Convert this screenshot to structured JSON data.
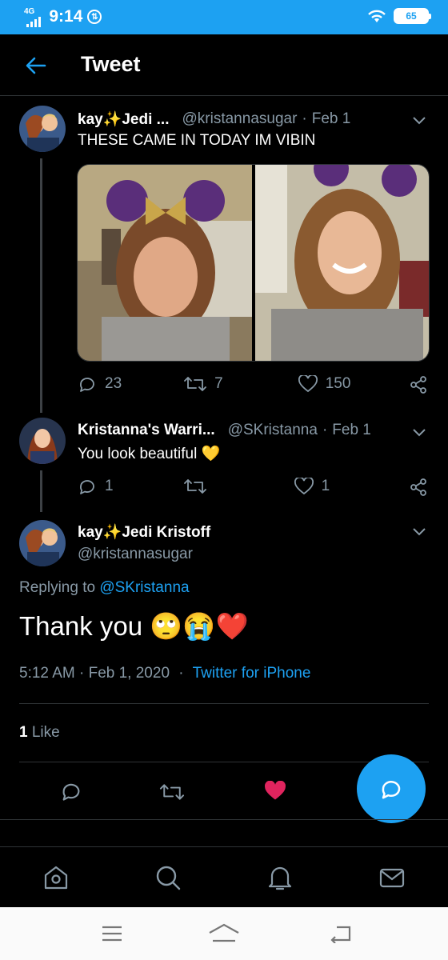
{
  "status_bar": {
    "network": "4G",
    "time": "9:14",
    "battery": "65"
  },
  "header": {
    "title": "Tweet"
  },
  "tweet1": {
    "name": "kay✨Jedi ...",
    "handle": "@kristannasugar",
    "date": "Feb 1",
    "text": "THESE CAME IN TODAY IM VIBIN",
    "replies": "23",
    "retweets": "7",
    "likes": "150"
  },
  "tweet2": {
    "name": "Kristanna's Warri...",
    "handle": "@SKristanna",
    "date": "Feb 1",
    "text": "You look beautiful 💛",
    "replies": "1",
    "likes": "1"
  },
  "main_tweet": {
    "name": "kay✨Jedi Kristoff",
    "handle": "@kristannasugar",
    "replying_prefix": "Replying to",
    "replying_to": "@SKristanna",
    "text": "Thank you 🙄😭❤️",
    "timestamp": "5:12 AM · Feb 1, 2020",
    "source": "Twitter for iPhone",
    "like_count": "1",
    "like_label": "Like"
  },
  "colors": {
    "accent": "#1da1f2",
    "like": "#e0245e",
    "muted": "#8899a6",
    "background": "#000000"
  },
  "icons": {
    "back": "arrow-left-icon",
    "reply": "reply-icon",
    "retweet": "retweet-icon",
    "like": "heart-icon",
    "share": "share-icon",
    "caret": "chevron-down-icon",
    "fab": "compose-reply-icon",
    "tabs": [
      "home-icon",
      "search-icon",
      "notifications-icon",
      "messages-icon"
    ],
    "nav": [
      "menu-icon",
      "home-nav-icon",
      "back-nav-icon"
    ]
  }
}
